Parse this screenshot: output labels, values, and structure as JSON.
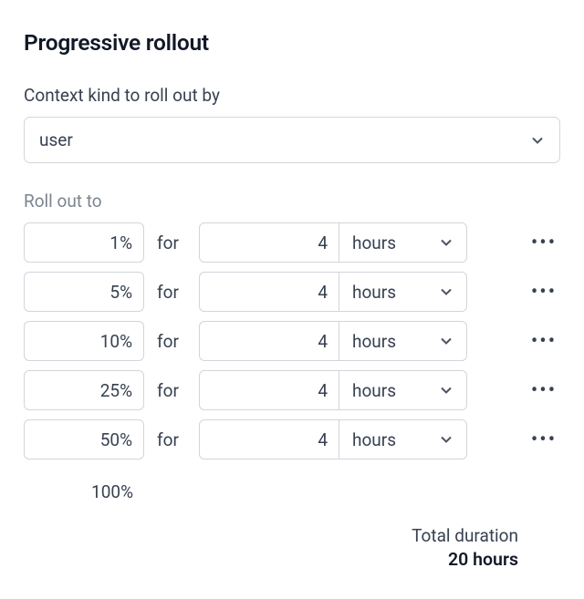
{
  "title": "Progressive rollout",
  "context_section": {
    "label": "Context kind to roll out by",
    "selected": "user"
  },
  "rollout_section": {
    "label": "Roll out to",
    "for_label": "for",
    "stages": [
      {
        "percent": "1%",
        "duration": "4",
        "unit": "hours"
      },
      {
        "percent": "5%",
        "duration": "4",
        "unit": "hours"
      },
      {
        "percent": "10%",
        "duration": "4",
        "unit": "hours"
      },
      {
        "percent": "25%",
        "duration": "4",
        "unit": "hours"
      },
      {
        "percent": "50%",
        "duration": "4",
        "unit": "hours"
      }
    ],
    "final_percent": "100%"
  },
  "total": {
    "label": "Total duration",
    "value": "20 hours"
  }
}
